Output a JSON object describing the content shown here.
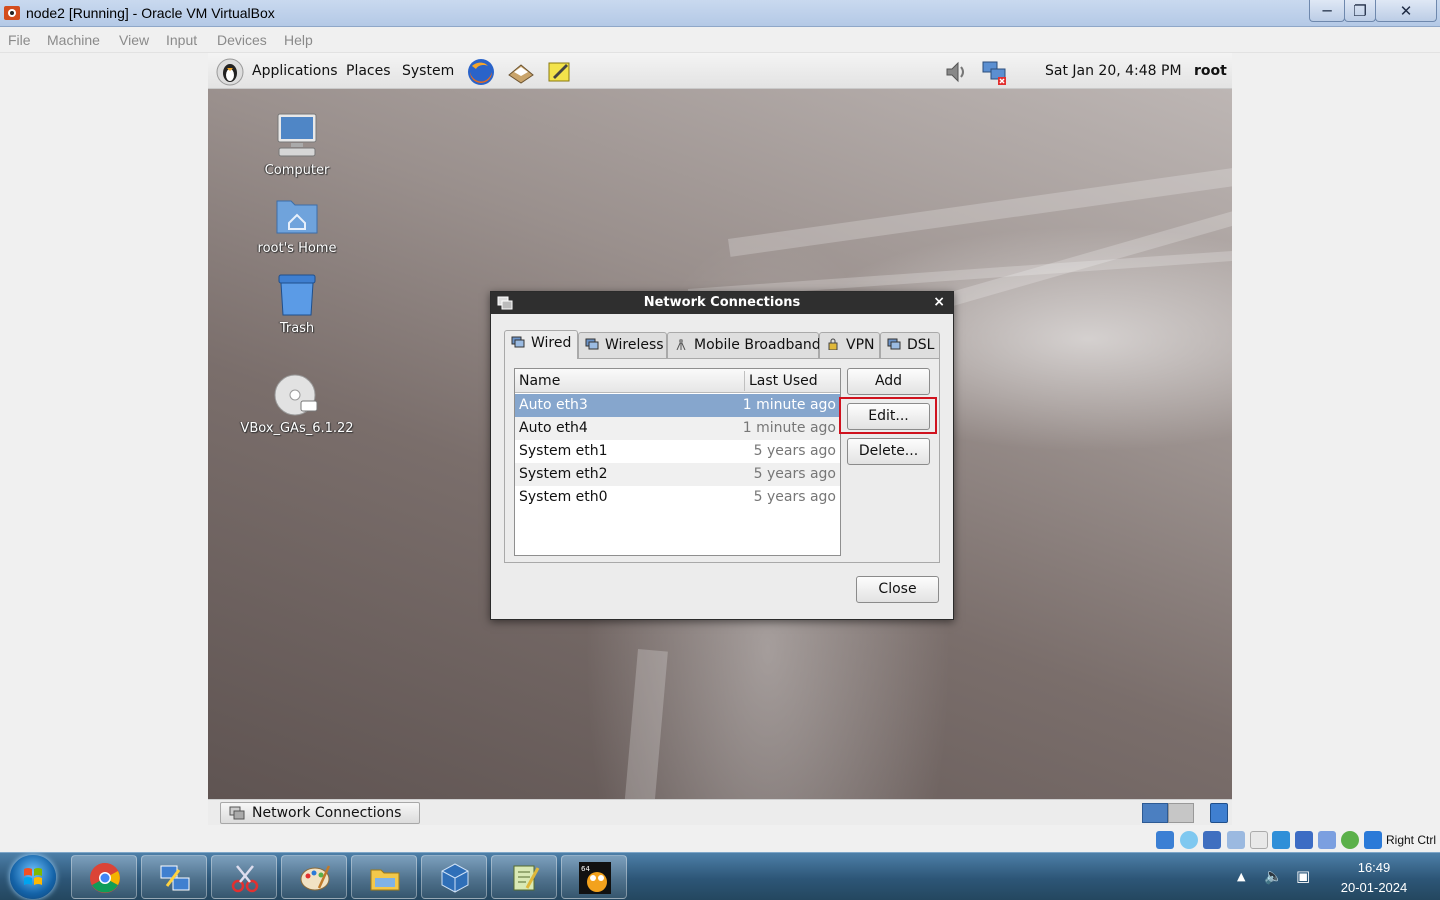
{
  "host_window": {
    "title": "node2 [Running] - Oracle VM VirtualBox",
    "menu": [
      "File",
      "Machine",
      "View",
      "Input",
      "Devices",
      "Help"
    ]
  },
  "guest_panel": {
    "menus": [
      "Applications",
      "Places",
      "System"
    ],
    "datetime": "Sat Jan 20,  4:48 PM",
    "user": "root"
  },
  "desktop_icons": [
    {
      "label": "Computer",
      "icon": "computer-icon"
    },
    {
      "label": "root's Home",
      "icon": "home-folder-icon"
    },
    {
      "label": "Trash",
      "icon": "trash-icon"
    },
    {
      "label": "VBox_GAs_6.1.22",
      "icon": "cd-icon"
    }
  ],
  "dialog": {
    "title": "Network Connections",
    "tabs": [
      {
        "label": "Wired",
        "active": true
      },
      {
        "label": "Wireless",
        "active": false
      },
      {
        "label": "Mobile Broadband",
        "active": false
      },
      {
        "label": "VPN",
        "active": false
      },
      {
        "label": "DSL",
        "active": false
      }
    ],
    "columns": {
      "name": "Name",
      "last_used": "Last Used"
    },
    "rows": [
      {
        "name": "Auto eth3",
        "last_used": "1 minute ago",
        "selected": true
      },
      {
        "name": "Auto eth4",
        "last_used": "1 minute ago",
        "selected": false
      },
      {
        "name": "System eth1",
        "last_used": "5 years ago",
        "selected": false
      },
      {
        "name": "System eth2",
        "last_used": "5 years ago",
        "selected": false
      },
      {
        "name": "System eth0",
        "last_used": "5 years ago",
        "selected": false
      }
    ],
    "buttons": {
      "add": "Add",
      "edit": "Edit...",
      "delete": "Delete...",
      "close": "Close"
    }
  },
  "guest_taskbar": {
    "item": "Network Connections"
  },
  "vb_status": {
    "host_key": "Right Ctrl"
  },
  "win_taskbar": {
    "time": "16:49",
    "date": "20-01-2024"
  },
  "colors": {
    "selection": "#86a6cd",
    "highlight_box": "#d0121e",
    "dialog_titlebar": "#2f2f2f"
  }
}
